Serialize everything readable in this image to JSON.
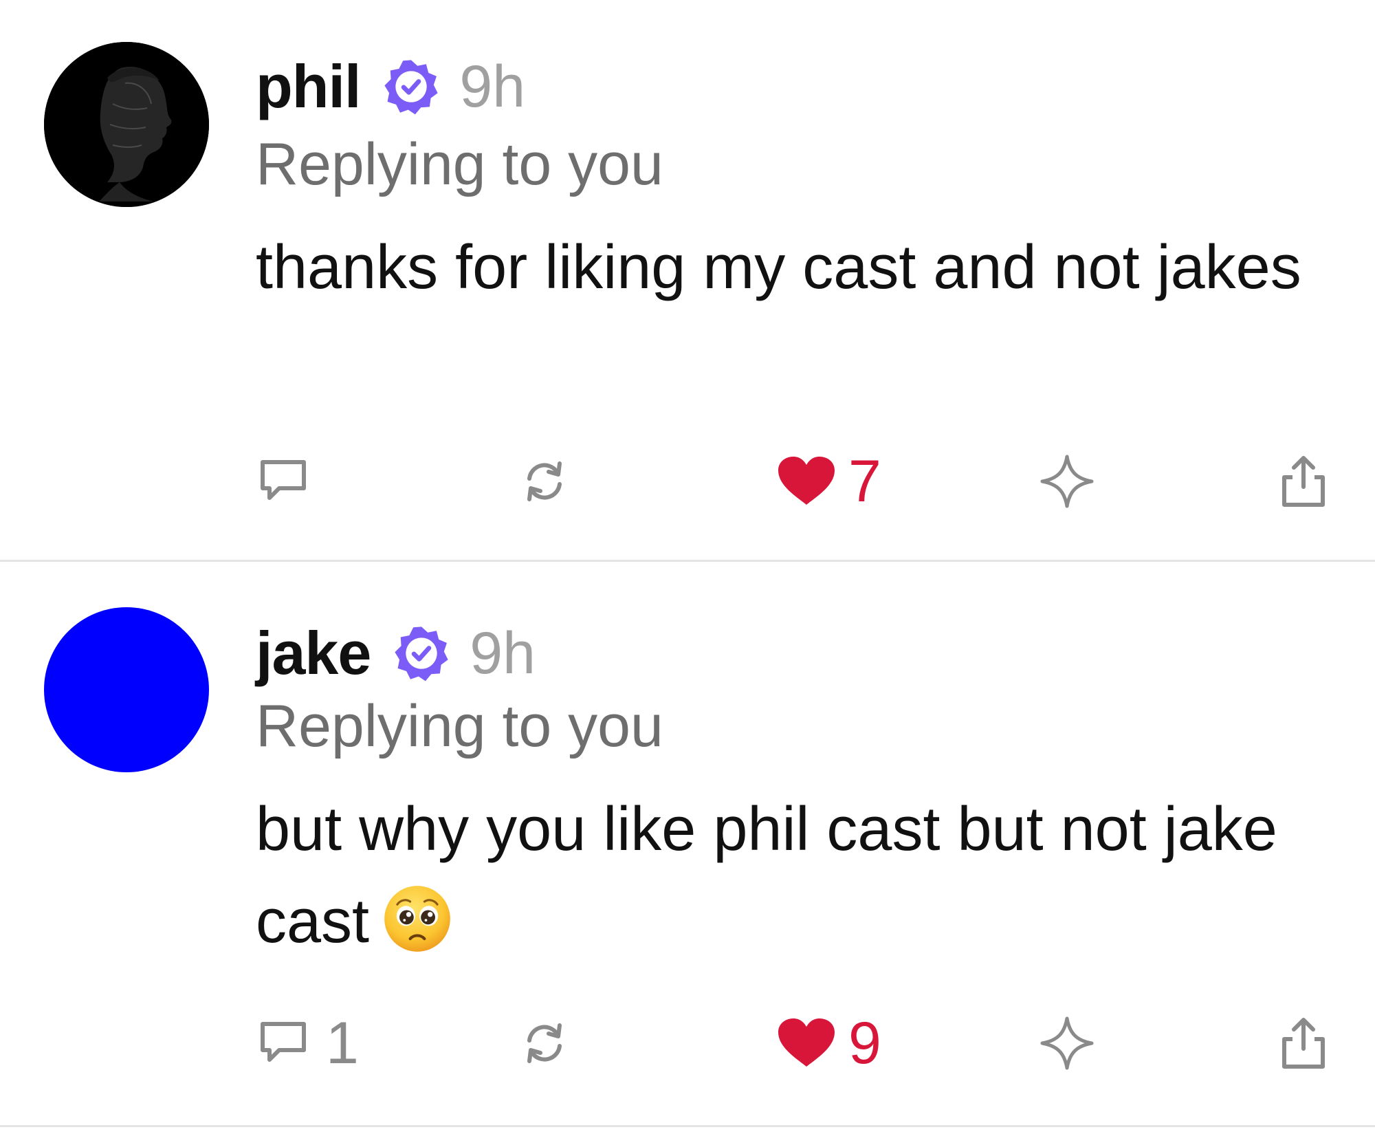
{
  "casts": [
    {
      "username": "phil",
      "time": "9h",
      "replying": "Replying to you",
      "text": "thanks for liking my cast and not jakes",
      "avatar_color": "#000000",
      "verified_color": "#7c5cf6",
      "reply_count": "",
      "likes": "7",
      "liked": true,
      "like_color": "#d7163a"
    },
    {
      "username": "jake",
      "time": "9h",
      "replying": "Replying to you",
      "text": "but why you like phil cast but not jake cast",
      "emoji": "pleading-face-emoji",
      "avatar_color": "#0000ff",
      "verified_color": "#7c5cf6",
      "reply_count": "1",
      "likes": "9",
      "liked": true,
      "like_color": "#d7163a"
    }
  ],
  "icons": {
    "reply": "comment-icon",
    "recast": "recast-icon",
    "like": "heart-icon",
    "star": "sparkle-icon",
    "share": "share-icon"
  }
}
